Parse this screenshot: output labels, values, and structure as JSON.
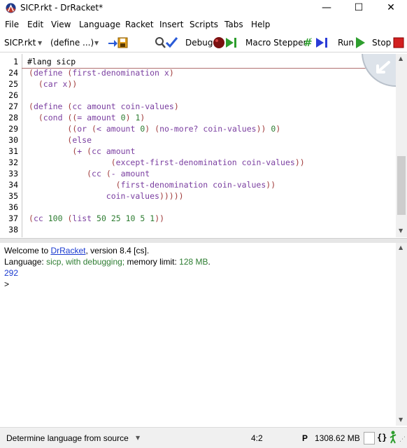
{
  "window": {
    "title": "SICP.rkt - DrRacket*",
    "minimize": "—",
    "maximize": "☐",
    "close": "✕"
  },
  "menu": [
    "File",
    "Edit",
    "View",
    "Language",
    "Racket",
    "Insert",
    "Scripts",
    "Tabs",
    "Help"
  ],
  "toolbar": {
    "file_selector": "SICP.rkt",
    "define_selector": "(define ...)",
    "debug_label": "Debug",
    "macro_stepper_label": "Macro Stepper",
    "run_label": "Run",
    "stop_label": "Stop"
  },
  "editor": {
    "lang_line": "#lang sicp",
    "first_line_number": "1",
    "line_numbers": [
      "24",
      "25",
      "26",
      "27",
      "28",
      "29",
      "30",
      "31",
      "32",
      "33",
      "34",
      "35",
      "36",
      "37",
      "38"
    ],
    "colors": {
      "keyword": "#7a3ea0",
      "paren": "#a03a3a",
      "identifier": "#7a3ea0",
      "number": "#2e7d32",
      "gutter_text": "#000000"
    }
  },
  "repl": {
    "welcome_prefix": "Welcome to ",
    "welcome_link": "DrRacket",
    "welcome_suffix": ", version 8.4 [cs].",
    "language_prefix": "Language: ",
    "language_value": "sicp, with debugging;",
    "memory_prefix": " memory limit: ",
    "memory_value": "128 MB",
    "memory_suffix": ".",
    "result": "292",
    "prompt": ">"
  },
  "statusbar": {
    "language_selector": "Determine language from source",
    "position": "4:2",
    "p_label": "P",
    "memory": "1308.62 MB"
  }
}
